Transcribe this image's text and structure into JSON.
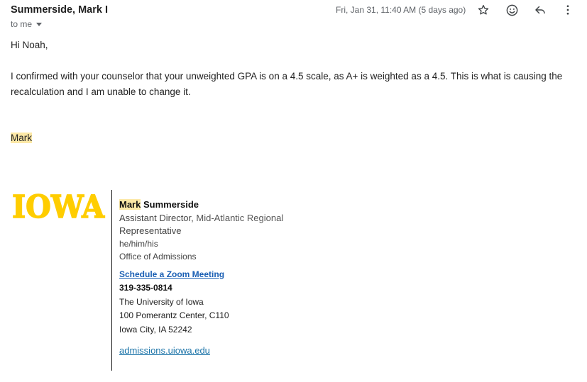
{
  "header": {
    "sender": "Summerside, Mark I",
    "recipient": "to me",
    "date": "Fri, Jan 31, 11:40 AM (5 days ago)",
    "icons": [
      "star-icon",
      "emoji-icon",
      "reply-icon",
      "more-vert-icon"
    ]
  },
  "message": {
    "greeting": "Hi Noah,",
    "line1": "I confirmed with your counselor that your unweighted GPA is on a 4.5 scale, as A+ is weighted as a 4.5. This is what is causing the",
    "line2": "recalculation and I am unable to change it.",
    "signoff": "Mark"
  },
  "signature": {
    "logo": "IOWA",
    "first_name": "Mark",
    "last_name": "Summerside",
    "title_line1_a": "Assistant Director,",
    "title_line1_b": "Mid-Atlantic Regional",
    "title_line2": "Representative",
    "pronouns": "he/him/his",
    "office": "Office of Admissions",
    "zoom_link": "Schedule a Zoom Meeting",
    "phone": "319-335-0814",
    "university": "The University of Iowa",
    "address1": "100 Pomerantz Center, C110",
    "address2": "Iowa City, IA 52242",
    "website": "admissions.uiowa.edu"
  },
  "colors": {
    "brand_gold": "#FFCD00",
    "highlight": "#fce8a6",
    "link": "#1a5fb4"
  }
}
